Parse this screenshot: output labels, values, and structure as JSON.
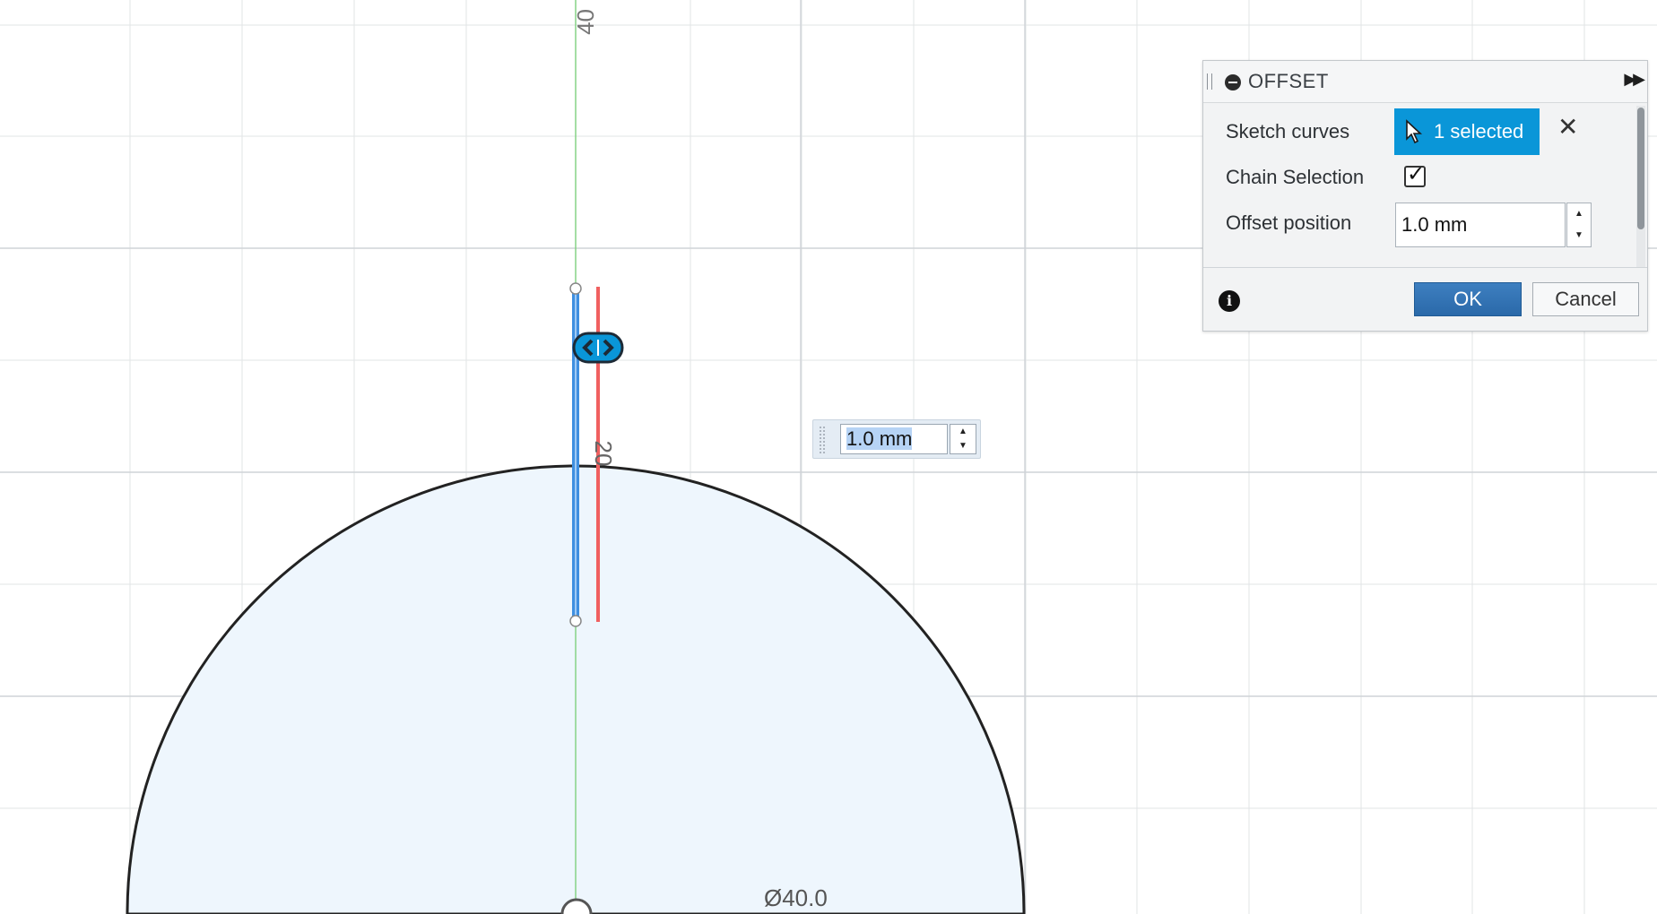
{
  "canvas": {
    "dim_top": "40",
    "dim_line": "20",
    "dim_circle": "Ø40.0",
    "floating_value": "1.0 mm"
  },
  "dialog": {
    "title": "OFFSET",
    "rows": {
      "sketch_curves_label": "Sketch curves",
      "sketch_curves_value": "1 selected",
      "chain_selection_label": "Chain Selection",
      "chain_selection_checked": true,
      "offset_position_label": "Offset position",
      "offset_position_value": "1.0 mm"
    },
    "ok_label": "OK",
    "cancel_label": "Cancel"
  },
  "colors": {
    "selection_blue": "#0a96d8",
    "circle_fill": "#eef6fd",
    "axis_green": "#7ed07e",
    "offset_red": "#f06060",
    "selected_line": "#3f8fe0"
  }
}
